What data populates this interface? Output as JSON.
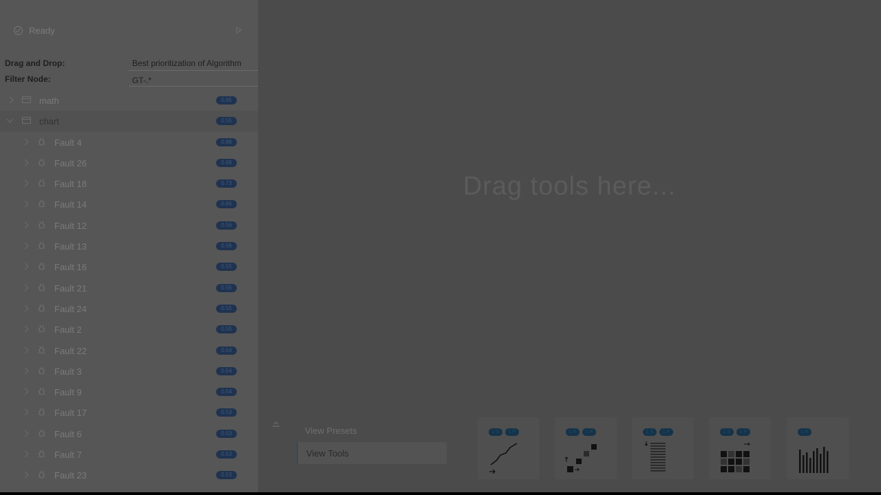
{
  "status": {
    "text": "Ready"
  },
  "form": {
    "drag_label": "Drag and Drop:",
    "drag_value": "Best prioritization of Algorithm",
    "filter_label": "Filter Node:",
    "filter_value": "GT-.*"
  },
  "tree": [
    {
      "name": "math",
      "score": "0.65",
      "level": 0,
      "open": false
    },
    {
      "name": "chart",
      "score": "0.55",
      "level": 0,
      "open": true
    },
    {
      "name": "Fault 4",
      "score": "0.88",
      "level": 1
    },
    {
      "name": "Fault 26",
      "score": "0.88",
      "level": 1
    },
    {
      "name": "Fault 18",
      "score": "0.73",
      "level": 1
    },
    {
      "name": "Fault 14",
      "score": "0.66",
      "level": 1
    },
    {
      "name": "Fault 12",
      "score": "0.56",
      "level": 1
    },
    {
      "name": "Fault 13",
      "score": "0.56",
      "level": 1
    },
    {
      "name": "Fault 16",
      "score": "0.55",
      "level": 1
    },
    {
      "name": "Fault 21",
      "score": "0.55",
      "level": 1
    },
    {
      "name": "Fault 24",
      "score": "0.55",
      "level": 1
    },
    {
      "name": "Fault 2",
      "score": "0.55",
      "level": 1
    },
    {
      "name": "Fault 22",
      "score": "0.54",
      "level": 1
    },
    {
      "name": "Fault 3",
      "score": "0.54",
      "level": 1
    },
    {
      "name": "Fault 9",
      "score": "0.54",
      "level": 1
    },
    {
      "name": "Fault 17",
      "score": "0.53",
      "level": 1
    },
    {
      "name": "Fault 6",
      "score": "0.53",
      "level": 1
    },
    {
      "name": "Fault 7",
      "score": "0.53",
      "level": 1
    },
    {
      "name": "Fault 23",
      "score": "0.53",
      "level": 1
    }
  ],
  "canvas": {
    "drop_hint": "Drag tools here..."
  },
  "panel": {
    "tab_presets": "View Presets",
    "tab_tools": "View Tools"
  },
  "tools": [
    {
      "icon": "line-chart-icon",
      "badges": [
        "1 S",
        "1 P"
      ]
    },
    {
      "icon": "step-chart-icon",
      "badges": [
        "1 S",
        "1 P"
      ]
    },
    {
      "icon": "stacked-bars-icon",
      "badges": [
        "1 S",
        "1 P"
      ]
    },
    {
      "icon": "grid-matrix-icon",
      "badges": [
        "1 S",
        "1 P"
      ]
    },
    {
      "icon": "bar-chart-icon",
      "badges": [
        "1 S"
      ]
    }
  ],
  "colors": {
    "background": "#4b4b4b",
    "sidebar": "#565656",
    "badge": "#1f3350",
    "accent": "#2e4a63"
  }
}
